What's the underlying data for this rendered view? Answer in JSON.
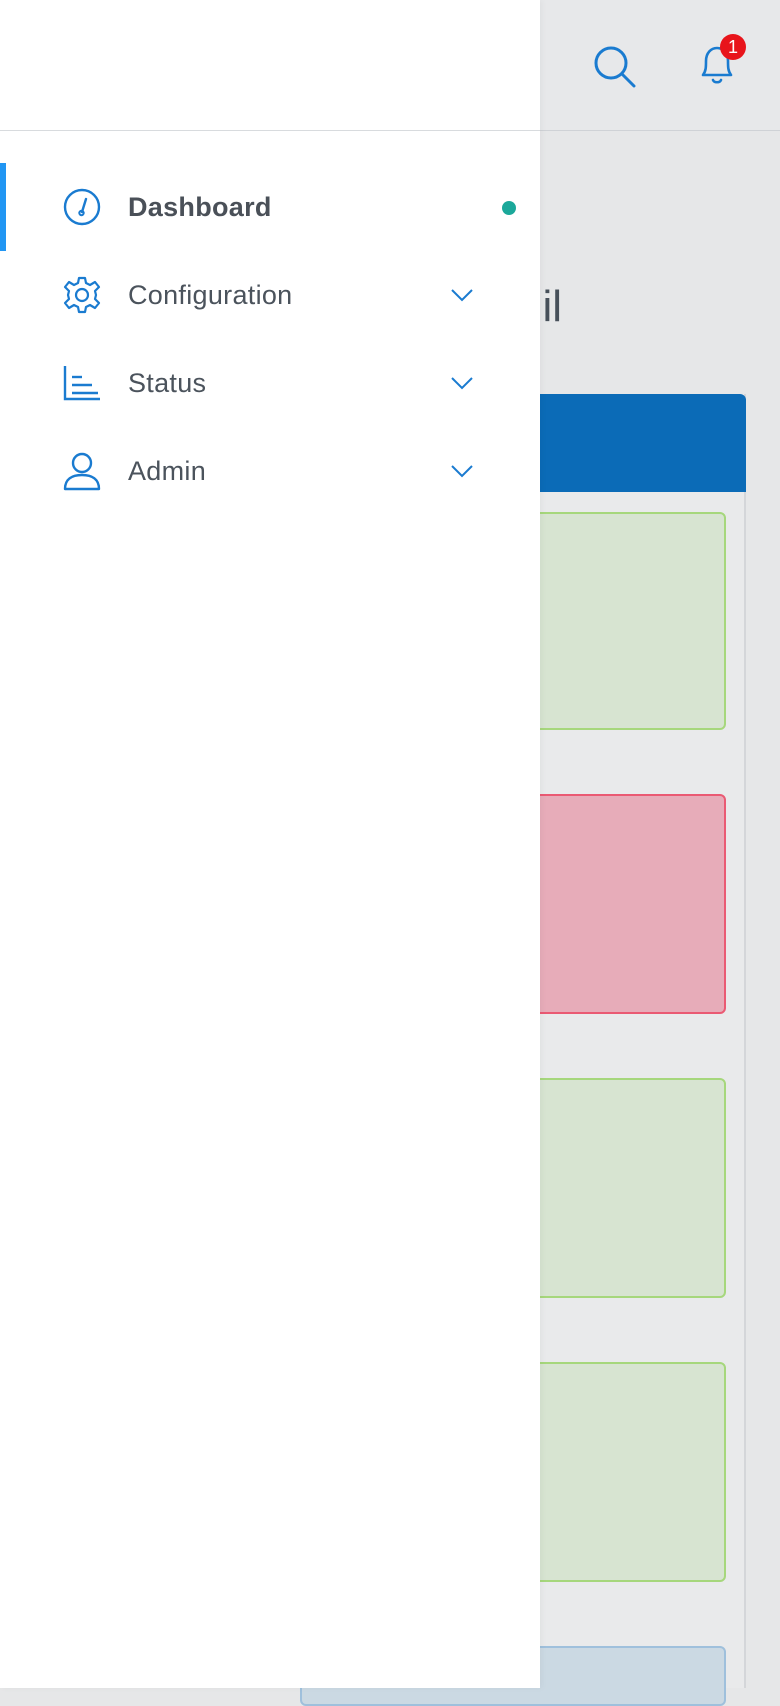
{
  "header": {
    "notification_count": "1"
  },
  "page": {
    "title_fragment": "il"
  },
  "sidebar": {
    "items": [
      {
        "label": "Dashboard",
        "icon": "dashboard-gauge-icon",
        "active": true
      },
      {
        "label": "Configuration",
        "icon": "gear-icon",
        "expandable": true
      },
      {
        "label": "Status",
        "icon": "bar-chart-icon",
        "expandable": true
      },
      {
        "label": "Admin",
        "icon": "user-icon",
        "expandable": true
      }
    ]
  },
  "colors": {
    "accent": "#2196f3",
    "icon": "#1a7bd0",
    "active_dot": "#1ba89a",
    "panel_header": "#0b6bb7",
    "tile_ok_bg": "#d7e4d1",
    "tile_ok_border": "#a6d77c",
    "tile_bad_bg": "#e7acb9",
    "tile_bad_border": "#ea5a73",
    "badge": "#e8141b"
  }
}
